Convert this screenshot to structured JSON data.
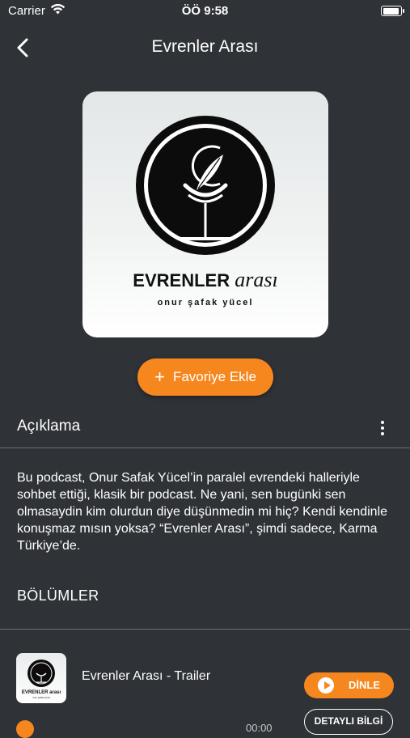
{
  "status_bar": {
    "carrier": "Carrier",
    "time": "ÖÖ 9:58"
  },
  "nav": {
    "title": "Evrenler Arası"
  },
  "cover": {
    "logo_wordmark": "EVRENLER arası",
    "logo_subtitle": "onur şafak yücel"
  },
  "favorite_button": {
    "label": "Favoriye Ekle"
  },
  "description": {
    "heading": "Açıklama",
    "body": "Bu podcast, Onur Safak Yücel’in paralel evrendeki halleriyle sohbet ettiği, klasik bir podcast. Ne yani, sen bugünki sen olmasaydin kim olurdun diye düşünmedin mi hiç? Kendi kendinle konuşmaz mısın yoksa? “Evrenler Arası”, şimdi sadece, Karma Türkiye’de."
  },
  "episodes": {
    "heading": "BÖLÜMLER",
    "items": [
      {
        "title": "Evrenler Arası - Trailer",
        "listen_label": "DİNLE",
        "detail_label": "DETAYLI BİLGİ",
        "duration": "00:00"
      }
    ]
  },
  "colors": {
    "background": "#2f3237",
    "accent": "#f6871f",
    "divider": "#6b6e73"
  },
  "icons": [
    "wifi-icon",
    "battery-icon",
    "back-chevron-icon",
    "plus-icon",
    "more-vertical-icon",
    "play-icon"
  ]
}
